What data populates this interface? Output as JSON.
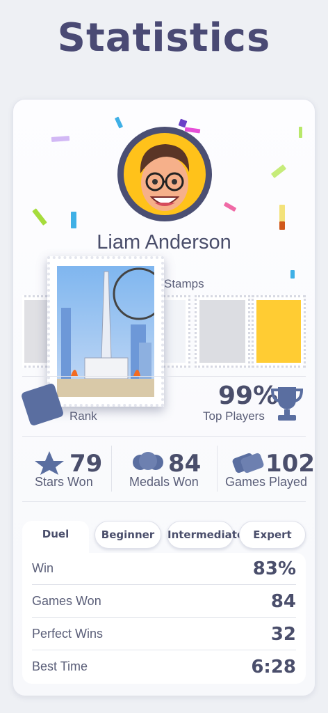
{
  "page": {
    "title": "Statistics"
  },
  "profile": {
    "name": "Liam Anderson",
    "avatar_icon": "avatar-face-icon"
  },
  "stamps": {
    "label": "Stamps",
    "featured": "bangkok-stamp",
    "items": [
      "radio-stamp",
      "skier-stamp",
      "character-stamp",
      "beehive-stamp"
    ]
  },
  "rank": {
    "label": "Rank",
    "percent": "99%",
    "percent_label": "Top Players"
  },
  "stats": [
    {
      "value": "79",
      "label": "Stars Won",
      "icon": "stars-icon"
    },
    {
      "value": "84",
      "label": "Medals Won",
      "icon": "medals-icon"
    },
    {
      "value": "102",
      "label": "Games Played",
      "icon": "cards-icon"
    }
  ],
  "tabs": [
    {
      "label": "Duel",
      "active": true
    },
    {
      "label": "Beginner",
      "active": false
    },
    {
      "label": "Intermediate",
      "active": false
    },
    {
      "label": "Expert",
      "active": false
    }
  ],
  "rows": [
    {
      "label": "Win",
      "value": "83%"
    },
    {
      "label": "Games Won",
      "value": "84"
    },
    {
      "label": "Perfect Wins",
      "value": "32"
    },
    {
      "label": "Best Time",
      "value": "6:28"
    }
  ],
  "colors": {
    "accent": "#4a4a74",
    "avatar_bg": "#ffc21a",
    "background": "#eef0f4"
  }
}
